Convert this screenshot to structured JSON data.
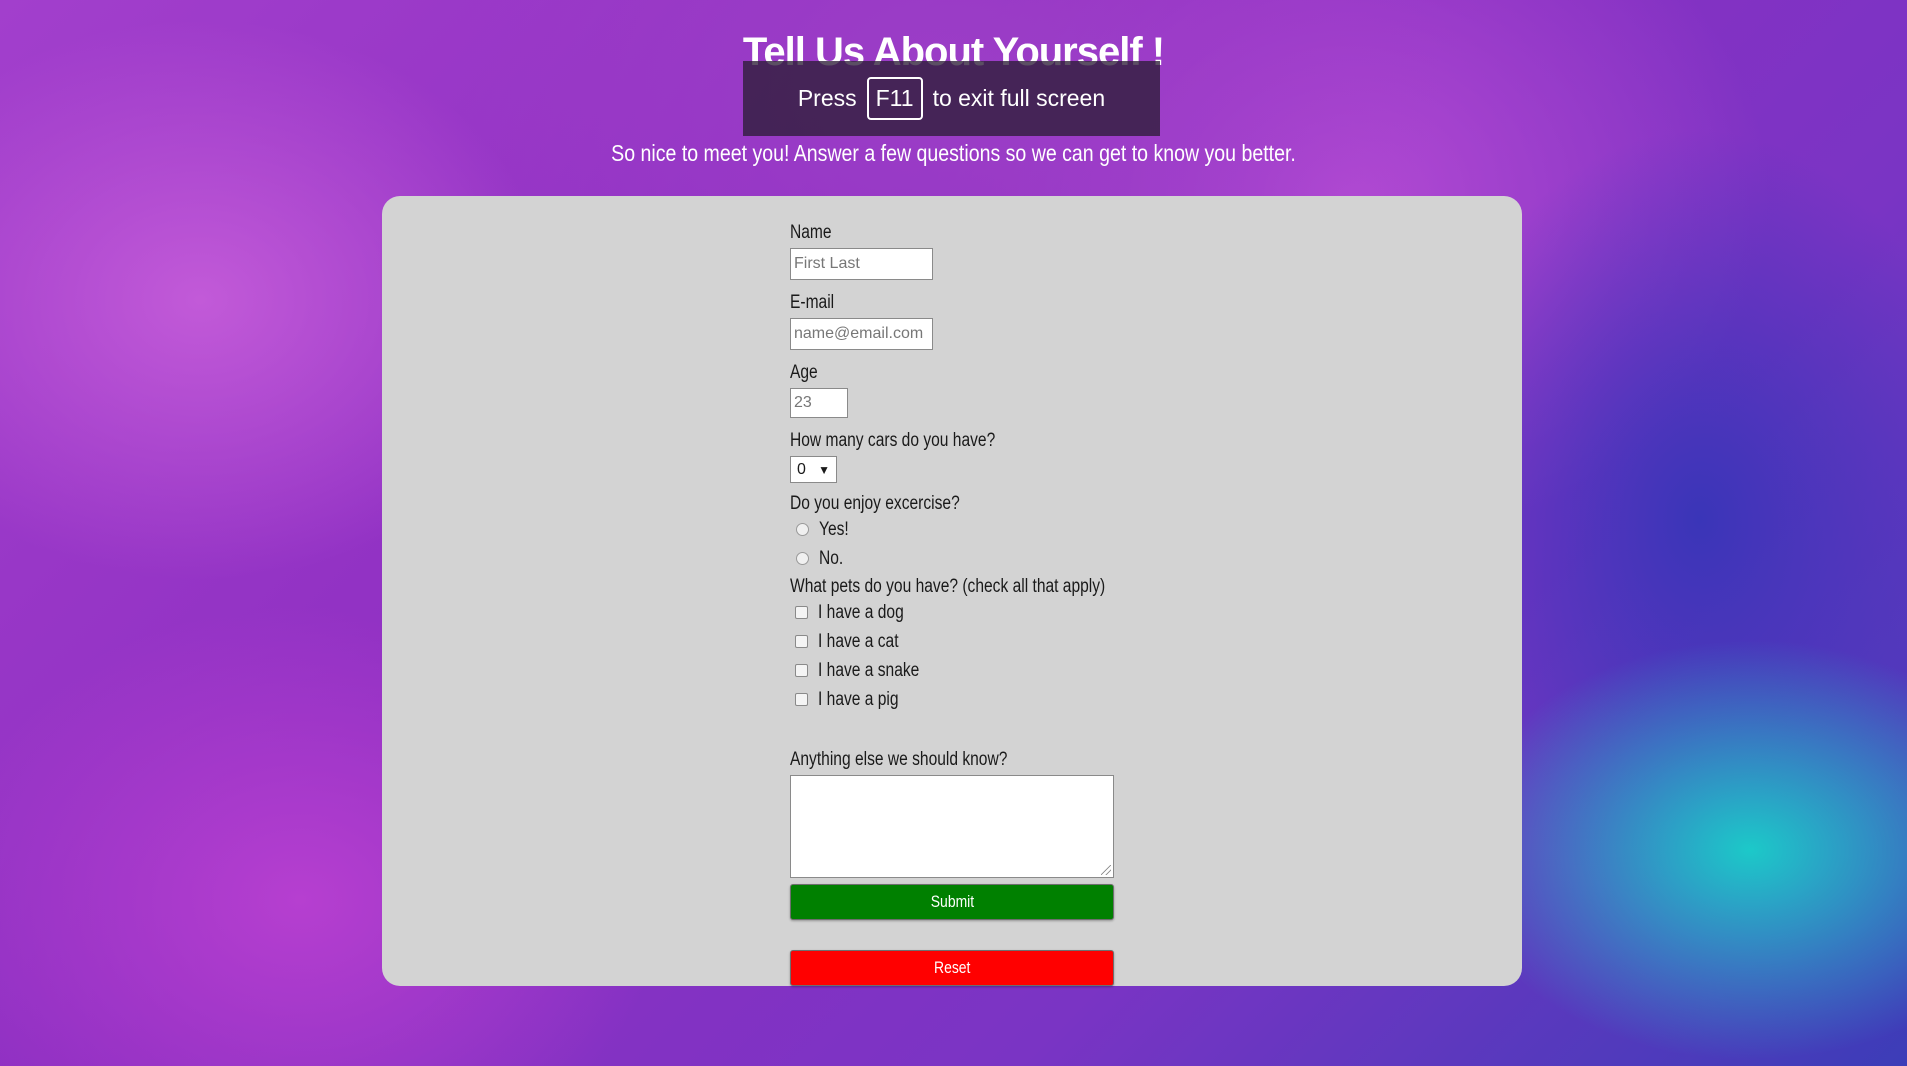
{
  "page": {
    "title": "Tell Us About Yourself !",
    "subtitle": "So nice to meet you! Answer a few questions so we can get to know you better."
  },
  "fullscreen_banner": {
    "press": "Press",
    "key": "F11",
    "message": "to exit full screen"
  },
  "form": {
    "name": {
      "label": "Name",
      "placeholder": "First Last"
    },
    "email": {
      "label": "E-mail",
      "placeholder": "name@email.com"
    },
    "age": {
      "label": "Age",
      "placeholder": "23"
    },
    "cars": {
      "label": "How many cars do you have?",
      "selected": "0",
      "arrow": "▼"
    },
    "exercise": {
      "label": "Do you enjoy excercise?",
      "options": [
        "Yes!",
        "No."
      ]
    },
    "pets": {
      "label": "What pets do you have? (check all that apply)",
      "options": [
        "I have a dog",
        "I have a cat",
        "I have a snake",
        "I have a pig"
      ]
    },
    "comments": {
      "label": "Anything else we should know?",
      "value": ""
    },
    "submit_label": "Submit",
    "reset_label": "Reset"
  },
  "colors": {
    "submit": "#008000",
    "reset": "#ff0000",
    "panel": "#d3d3d3"
  }
}
